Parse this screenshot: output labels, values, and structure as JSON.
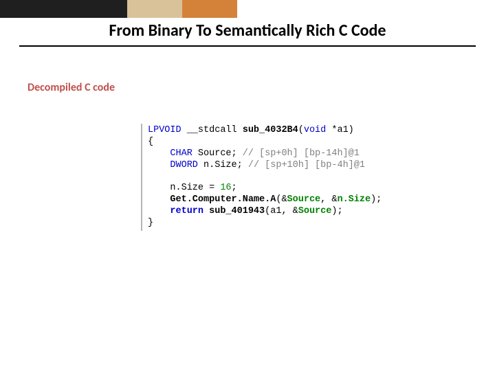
{
  "title": "From Binary To Semantically Rich C Code",
  "section_label": "Decompiled C code",
  "code": {
    "line1_type": "LPVOID",
    "line1_call": " __stdcall ",
    "line1_func": "sub_4032B4",
    "line1_open": "(",
    "line1_arg_type": "void",
    "line1_arg": " *a1)",
    "line2": "{",
    "line3_pad": "    ",
    "line3_type": "CHAR",
    "line3_var": " Source; ",
    "line3_cmt": "// [sp+0h] [bp-14h]@1",
    "line4_pad": "    ",
    "line4_type": "DWORD",
    "line4_var": " n.Size; ",
    "line4_cmt": "// [sp+10h] [bp-4h]@1",
    "blank": " ",
    "line6_pad": "    ",
    "line6_lhs": "n.Size = ",
    "line6_num": "16",
    "line6_semi": ";",
    "line7_pad": "    ",
    "line7_fn": "Get.Computer.Name.A",
    "line7_open": "(&",
    "line7_a1": "Source",
    "line7_mid": ", &",
    "line7_a2": "n.Size",
    "line7_close": ");",
    "line8_pad": "    ",
    "line8_ret": "return",
    "line8_sp": " ",
    "line8_fn": "sub_401943",
    "line8_open": "(a1, &",
    "line8_arg": "Source",
    "line8_close": ");",
    "line9": "}"
  }
}
